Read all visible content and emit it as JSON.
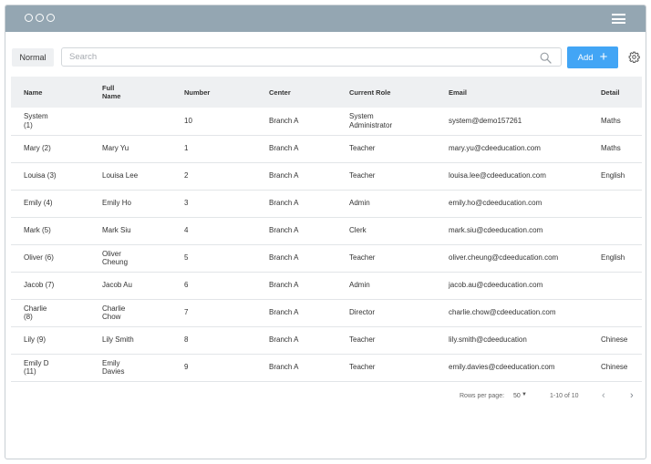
{
  "toolbar": {
    "mode_label": "Normal",
    "search_placeholder": "Search",
    "search_value": "",
    "add_label": "Add",
    "add_icon": "plus-icon",
    "settings_icon": "gear-icon"
  },
  "table": {
    "headers": {
      "name": "Name",
      "full_name": "Full\nName",
      "number": "Number",
      "center": "Center",
      "role": "Current Role",
      "email": "Email",
      "detail": "Detail"
    },
    "rows": [
      {
        "name": "System\n(1)",
        "full_name": "",
        "number": "10",
        "center": "Branch A",
        "role": "System\nAdministrator",
        "email": "system@demo157261",
        "detail": "Maths"
      },
      {
        "name": "Mary (2)",
        "full_name": "Mary Yu",
        "number": "1",
        "center": "Branch A",
        "role": "Teacher",
        "email": "mary.yu@cdeeducation.com",
        "detail": "Maths"
      },
      {
        "name": "Louisa (3)",
        "full_name": "Louisa Lee",
        "number": "2",
        "center": "Branch A",
        "role": "Teacher",
        "email": "louisa.lee@cdeeducation.com",
        "detail": "English"
      },
      {
        "name": "Emily (4)",
        "full_name": "Emily Ho",
        "number": "3",
        "center": "Branch A",
        "role": "Admin",
        "email": "emily.ho@cdeeducation.com",
        "detail": ""
      },
      {
        "name": "Mark (5)",
        "full_name": "Mark Siu",
        "number": "4",
        "center": "Branch A",
        "role": "Clerk",
        "email": "mark.siu@cdeeducation.com",
        "detail": ""
      },
      {
        "name": "Oliver (6)",
        "full_name": "Oliver\nCheung",
        "number": "5",
        "center": "Branch A",
        "role": "Teacher",
        "email": "oliver.cheung@cdeeducation.com",
        "detail": "English"
      },
      {
        "name": "Jacob (7)",
        "full_name": "Jacob Au",
        "number": "6",
        "center": "Branch A",
        "role": "Admin",
        "email": "jacob.au@cdeeducation.com",
        "detail": ""
      },
      {
        "name": "Charlie\n(8)",
        "full_name": "Charlie\nChow",
        "number": "7",
        "center": "Branch A",
        "role": "Director",
        "email": "charlie.chow@cdeeducation.com",
        "detail": ""
      },
      {
        "name": "Lily (9)",
        "full_name": "Lily Smith",
        "number": "8",
        "center": "Branch A",
        "role": "Teacher",
        "email": "lily.smith@cdeeducation",
        "detail": "Chinese"
      },
      {
        "name": "Emily D\n(11)",
        "full_name": "Emily\nDavies",
        "number": "9",
        "center": "Branch A",
        "role": "Teacher",
        "email": "emily.davies@cdeeducation.com",
        "detail": "Chinese"
      }
    ]
  },
  "pagination": {
    "rows_per_page_label": "Rows per page:",
    "rows_per_page_value": "50",
    "range_label": "1-10 of 10"
  },
  "colors": {
    "titlebar": "#94a6b2",
    "accent": "#42a5f5",
    "header_bg": "#eef0f2"
  }
}
